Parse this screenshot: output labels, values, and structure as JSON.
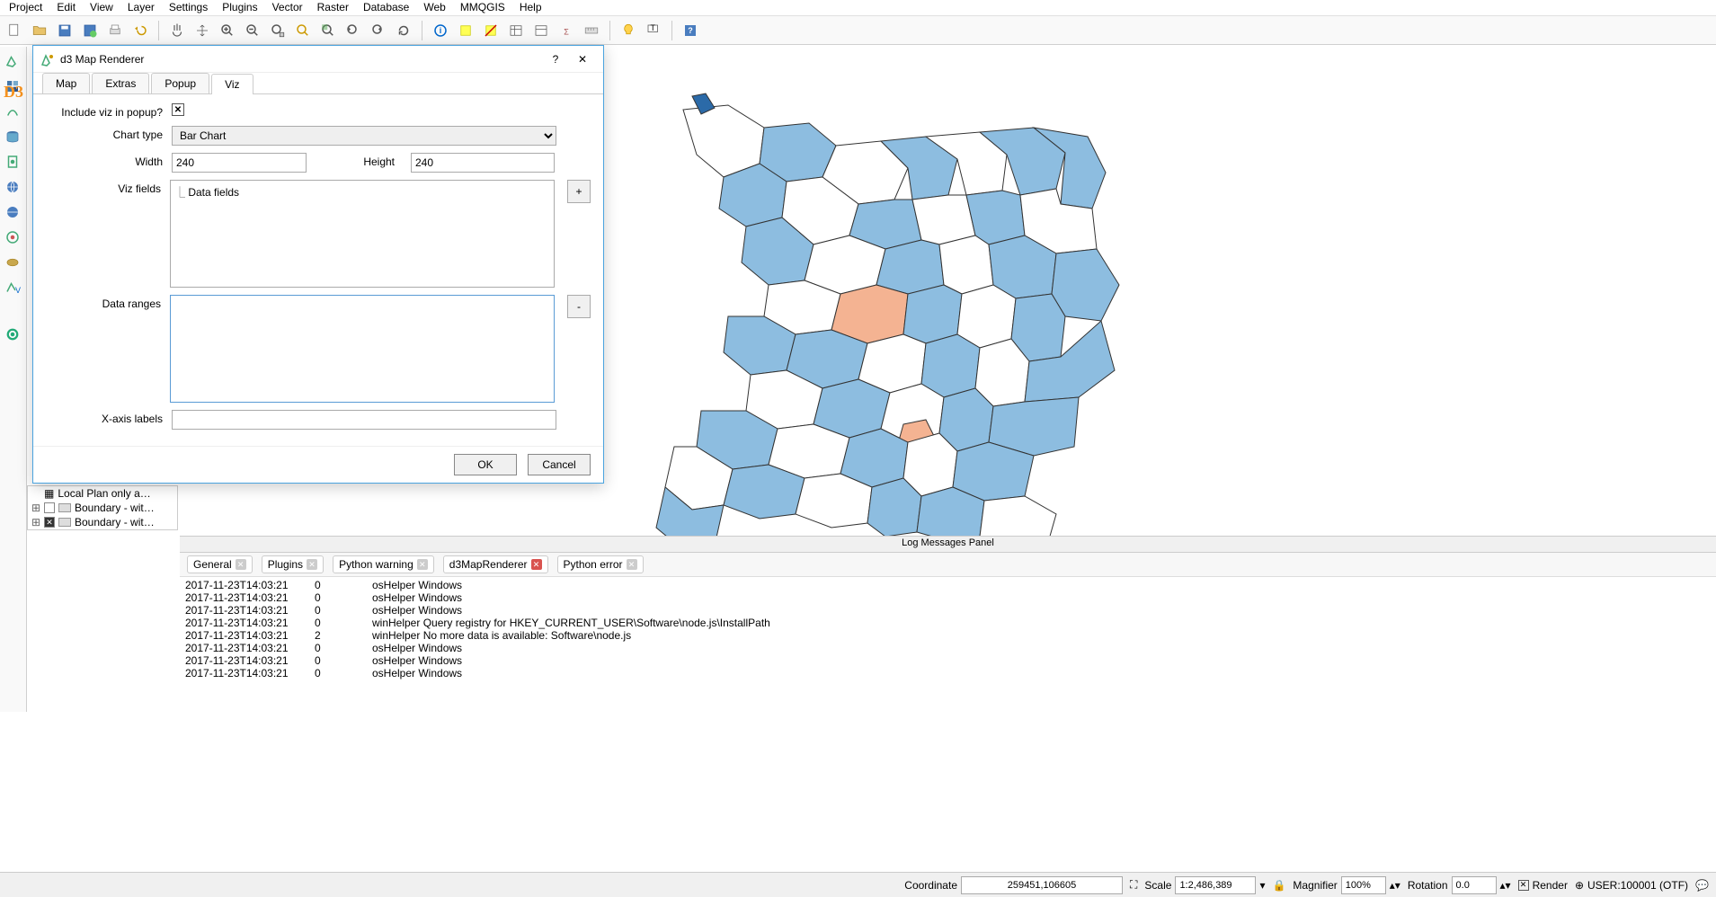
{
  "menu": [
    "Project",
    "Edit",
    "View",
    "Layer",
    "Settings",
    "Plugins",
    "Vector",
    "Raster",
    "Database",
    "Web",
    "MMQGIS",
    "Help"
  ],
  "dialog": {
    "title": "d3 Map Renderer",
    "tabs": [
      "Map",
      "Extras",
      "Popup",
      "Viz"
    ],
    "active_tab": 3,
    "include_label": "Include viz in popup?",
    "chart_type_label": "Chart type",
    "chart_type_value": "Bar Chart",
    "width_label": "Width",
    "width_value": "240",
    "height_label": "Height",
    "height_value": "240",
    "viz_fields_label": "Viz fields",
    "data_fields_text": "Data fields",
    "data_ranges_label": "Data ranges",
    "xaxis_label": "X-axis labels",
    "add_btn": "+",
    "remove_btn": "-",
    "ok": "OK",
    "cancel": "Cancel",
    "help": "?",
    "close": "✕"
  },
  "layers": [
    {
      "name": "Local Plan only a…"
    },
    {
      "name": "Boundary - wit…"
    },
    {
      "name": "Boundary - wit…"
    }
  ],
  "log": {
    "panel_title": "Log Messages Panel",
    "tabs": [
      "General",
      "Plugins",
      "Python warning",
      "d3MapRenderer",
      "Python error"
    ],
    "active_tab": 3,
    "lines": [
      [
        "2017-11-23T14:03:21",
        "0",
        "osHelper Windows"
      ],
      [
        "2017-11-23T14:03:21",
        "0",
        "osHelper Windows"
      ],
      [
        "2017-11-23T14:03:21",
        "0",
        "osHelper Windows"
      ],
      [
        "2017-11-23T14:03:21",
        "0",
        "winHelper Query registry for HKEY_CURRENT_USER\\Software\\node.js\\InstallPath"
      ],
      [
        "2017-11-23T14:03:21",
        "2",
        "winHelper No more data is available: Software\\node.js"
      ],
      [
        "2017-11-23T14:03:21",
        "0",
        "osHelper Windows"
      ],
      [
        "2017-11-23T14:03:21",
        "0",
        "osHelper Windows"
      ],
      [
        "2017-11-23T14:03:21",
        "0",
        "osHelper Windows"
      ]
    ]
  },
  "status": {
    "coord_label": "Coordinate",
    "coord_value": "259451,106605",
    "scale_label": "Scale",
    "scale_value": "1:2,486,389",
    "mag_label": "Magnifier",
    "mag_value": "100%",
    "rot_label": "Rotation",
    "rot_value": "0.0",
    "render_label": "Render",
    "crs": "USER:100001 (OTF)"
  },
  "d3_label": "D3"
}
